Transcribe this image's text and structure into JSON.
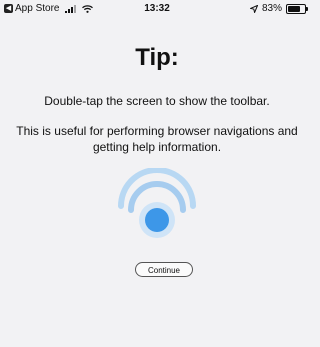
{
  "status_bar": {
    "back_app": "App Store",
    "time": "13:32",
    "battery_text": "83%",
    "battery_level": 0.83
  },
  "tip": {
    "title": "Tip:",
    "line1": "Double-tap the screen to show the toolbar.",
    "line2": "This is useful for performing browser navigations and getting help information.",
    "icon": "double-tap-icon",
    "continue_label": "Continue"
  },
  "colors": {
    "background": "#f2f2f4",
    "accent_blue": "#3d97e8",
    "wave_blue": "#a9cdf0"
  }
}
